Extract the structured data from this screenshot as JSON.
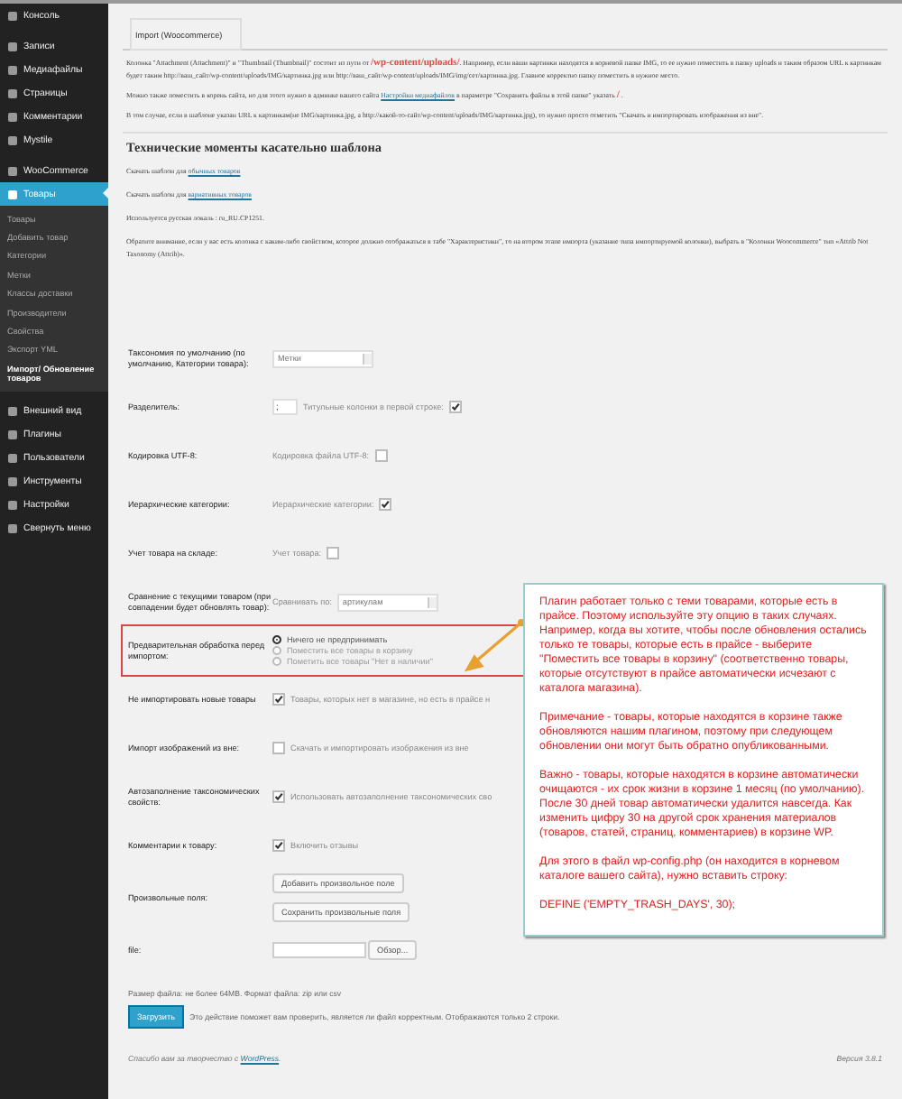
{
  "sidebar": {
    "items": [
      {
        "label": "Консоль",
        "selected": false
      },
      {
        "label": "Записи",
        "selected": false
      },
      {
        "label": "Медиафайлы",
        "selected": false
      },
      {
        "label": "Страницы",
        "selected": false
      },
      {
        "label": "Комментарии",
        "selected": false
      },
      {
        "label": "Mystile",
        "selected": false
      },
      {
        "label": "WooCommerce",
        "selected": false
      },
      {
        "label": "Товары",
        "selected": true,
        "children": [
          {
            "label": "Товары",
            "selected": false
          },
          {
            "label": "Добавить товар",
            "selected": false
          },
          {
            "label": "Категории",
            "selected": false
          },
          {
            "label": "Метки",
            "selected": false
          },
          {
            "label": "Классы доставки",
            "selected": false
          },
          {
            "label": "Производители",
            "selected": false
          },
          {
            "label": "Свойства",
            "selected": false
          },
          {
            "label": "Экспорт YML",
            "selected": false
          },
          {
            "label": "Импорт/ Обновление товаров",
            "selected": true
          }
        ]
      },
      {
        "label": "Внешний вид",
        "selected": false
      },
      {
        "label": "Плагины",
        "selected": false
      },
      {
        "label": "Пользователи",
        "selected": false
      },
      {
        "label": "Инструменты",
        "selected": false
      },
      {
        "label": "Настройки",
        "selected": false
      },
      {
        "label": "Свернуть меню",
        "selected": false
      }
    ]
  },
  "tab": {
    "label": "Import (Woocommerce)",
    "selected": true
  },
  "intro": [
    [
      {
        "kind": "text",
        "text": "Колонка \"Attachment (Attachment)\" и \"Thumbnail (Thumbnail)\" состоит из пути от "
      },
      {
        "kind": "code",
        "text": "/wp-content/uploads/"
      },
      {
        "kind": "text",
        "text": ". Например, если ваши картинки находятся в корневой папке IMG, то ее нужно поместить в папку uploads и таким образом URL к картинкам будет таким http://ваш_сайт/wp-content/uploads/IMG/картинка.jpg или http://ваш_сайт/wp-content/uploads/IMG/img/сет/картинка.jpg. Главное корректно папку поместить в нужное место."
      }
    ],
    [
      {
        "kind": "text",
        "text": "Можно также поместить в корень сайта, но для этого нужно в админке вашего сайта "
      },
      {
        "kind": "link",
        "text": "Настройки медиафайлов"
      },
      {
        "kind": "text",
        "text": " в параметре \"Сохранять файлы в этой папке\" указать "
      },
      {
        "kind": "code",
        "text": "/"
      },
      {
        "kind": "text",
        "text": " ."
      }
    ],
    [
      {
        "kind": "text",
        "text": "В том случае, если в шаблоне указан URL к картинкам(не IMG/картинка.jpg, а http://какой-то-сайт/wp-content/uploads/IMG/картинка.jpg), то нужно просто отметить \"Скачать и импортировать изображения из вне\"."
      }
    ]
  ],
  "heading": "Технические моменты касательно шаблона",
  "notes": [
    [
      {
        "kind": "text",
        "text": "Скачать шаблон для "
      },
      {
        "kind": "link",
        "text": "обычных товаров"
      }
    ],
    [
      {
        "kind": "text",
        "text": "Скачать шаблон для "
      },
      {
        "kind": "link",
        "text": "вариативных товаров"
      }
    ],
    [
      {
        "kind": "text",
        "text": "Используется русская локаль : ru_RU.CP1251."
      }
    ],
    [
      {
        "kind": "text",
        "text": "Обратите внимание, если у вас есть колонка с каким-либо свойством, которое должно отображаться в табе \"Характеристики\", то на втором этапе импорта (указание типа импортируемой колонки), выбрать в \"Колонки Woocommerce\" тип «Attrib Not Taxonomy (Attrib)»."
      }
    ]
  ],
  "form": {
    "rows": [
      {
        "kind": "select",
        "label": "Таксономия по умолчанию (по умолчанию, Категории товара):",
        "value": "Метки",
        "highlighted": false
      },
      {
        "kind": "input_check",
        "label": "Разделитель:",
        "value": ";",
        "text": "Титульные колонки в первой строке:",
        "checked": true,
        "highlighted": false
      },
      {
        "kind": "text_check",
        "label": "Кодировка UTF-8:",
        "text": "Кодировка файла UTF-8:",
        "checked": false,
        "highlighted": false
      },
      {
        "kind": "text_check",
        "label": "Иерархические категории:",
        "text": "Иерархические категории:",
        "checked": true,
        "highlighted": false
      },
      {
        "kind": "text_check",
        "label": "Учет товара на складе:",
        "text": "Учет товара:",
        "checked": false,
        "highlighted": false
      },
      {
        "kind": "select",
        "label": "Сравнение с текущими товаром (при совпадении будет обновлять товар):",
        "prefix": "Сравнивать по:",
        "value": "артикулам",
        "highlighted": false
      },
      {
        "kind": "radio",
        "label": "Предварительная обработка перед импортом:",
        "highlighted": true,
        "options": [
          {
            "label": "Ничего не предпринимать",
            "selected": true
          },
          {
            "label": "Поместить все товары в корзину",
            "selected": false
          },
          {
            "label": "Пометить все товары \"Нет в наличии\"",
            "selected": false
          }
        ]
      },
      {
        "kind": "check_text",
        "label": "Не импортировать новые товары",
        "text": "Товары, которых нет в магазине, но есть в прайсе н",
        "checked": true,
        "highlighted": false
      },
      {
        "kind": "check_text",
        "label": "Импорт изображений из вне:",
        "text": "Скачать и импортировать изображения из вне",
        "checked": false,
        "highlighted": false
      },
      {
        "kind": "check_text",
        "label": "Автозаполнение таксономических свойств:",
        "text": "Использовать автозаполнение таксономических сво",
        "checked": true,
        "highlighted": false
      },
      {
        "kind": "check_text",
        "label": "Комментарии к товару:",
        "text": "Включить отзывы",
        "checked": true,
        "highlighted": false
      },
      {
        "kind": "buttons",
        "label": "Произвольные поля:",
        "buttons": [
          "Добавить произвольное поле",
          "Сохранить произвольные поля"
        ],
        "highlighted": false
      },
      {
        "kind": "file",
        "label": "file:",
        "button": "Обзор...",
        "highlighted": false
      }
    ],
    "hint": "Размер файла: не более 64MB. Формат файла: zip или csv",
    "submit": "Загрузить",
    "submit_note": "Это действие поможет вам проверить, является ли файл корректным. Отображаются только 2 строки."
  },
  "callout": [
    "Плагин работает только с теми товарами, которые есть в прайсе. Поэтому используйте эту опцию в таких случаях. Например, когда вы хотите, чтобы после обновления остались только те товары, которые есть в прайсе - выберите \"Поместить все товары в корзину\" (соответственно товары, которые отсутствуют в прайсе автоматически исчезают с каталога магазина).",
    "Примечание - товары, которые находятся в корзине также обновляются нашим плагином, поэтому при следующем обновлении они могут быть обратно опубликованными.",
    "Важно - товары, которые находятся в корзине автоматически очищаются - их срок жизни в корзине 1 месяц (по умолчанию). После 30 дней товар автоматически удалится навсегда. Как изменить цифру 30 на другой срок хранения материалов (товаров, статей, страниц, комментариев) в корзине WP.",
    "Для этого в файл wp-config.php (он находится в корневом каталоге вашего сайта), нужно вставить строку:",
    "DEFINE ('EMPTY_TRASH_DAYS', 30);"
  ],
  "footer": {
    "text": "Спасибо вам за творчество с ",
    "link": "WordPress",
    "after": ".",
    "version": "Версия 3.8.1"
  }
}
